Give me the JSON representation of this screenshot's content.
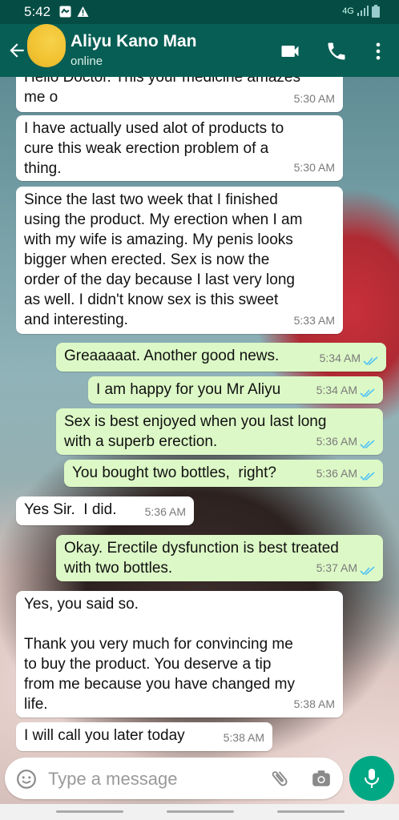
{
  "status_bar": {
    "time": "5:42",
    "network": "4G"
  },
  "header": {
    "contact_name": "Aliyu Kano Man",
    "contact_status": "online"
  },
  "messages": [
    {
      "dir": "in",
      "text": "Hello Doctor. This your medicine amazes\nme o",
      "time": "5:30 AM"
    },
    {
      "dir": "in",
      "text": "I have actually used alot of products to\ncure this weak erection problem of a\nthing.",
      "time": "5:30 AM"
    },
    {
      "dir": "in",
      "text": "Since the last two week that I finished\nusing the product. My erection when I am\nwith my wife is amazing. My penis looks\nbigger when erected. Sex is now the\norder of the day because I last very long\nas well. I didn't know sex is this sweet\nand interesting.",
      "time": "5:33 AM"
    },
    {
      "dir": "out",
      "text": "Greaaaaat. Another good news.",
      "time": "5:34 AM"
    },
    {
      "dir": "out",
      "text": "I am happy for you Mr Aliyu",
      "time": "5:34 AM"
    },
    {
      "dir": "out",
      "text": "Sex is best enjoyed when you last long\nwith a superb erection.",
      "time": "5:36 AM"
    },
    {
      "dir": "out",
      "text": "You bought two bottles,  right?",
      "time": "5:36 AM"
    },
    {
      "dir": "in",
      "text": "Yes Sir.  I did.",
      "time": "5:36 AM"
    },
    {
      "dir": "out",
      "text": "Okay. Erectile dysfunction is best treated\nwith two bottles.",
      "time": "5:37 AM"
    },
    {
      "dir": "in",
      "text": "Yes, you said so.\n\nThank you very much for convincing me\nto buy the product. You deserve a tip\nfrom me because you have changed my\nlife.",
      "time": "5:38 AM"
    },
    {
      "dir": "in",
      "text": "I will call you later today",
      "time": "5:38 AM"
    }
  ],
  "composer": {
    "placeholder": "Type a message"
  },
  "icons": {
    "back": "arrow-left-icon",
    "video": "video-call-icon",
    "call": "phone-icon",
    "menu": "more-vert-icon",
    "emoji": "emoji-icon",
    "attach": "paperclip-icon",
    "camera": "camera-icon",
    "mic": "mic-icon",
    "read": "double-check-icon"
  },
  "colors": {
    "header": "#075e54",
    "status_bar": "#054d44",
    "outgoing": "#dcf8c6",
    "incoming": "#ffffff",
    "read_ticks": "#4fc3f7",
    "mic_button": "#00a884"
  }
}
